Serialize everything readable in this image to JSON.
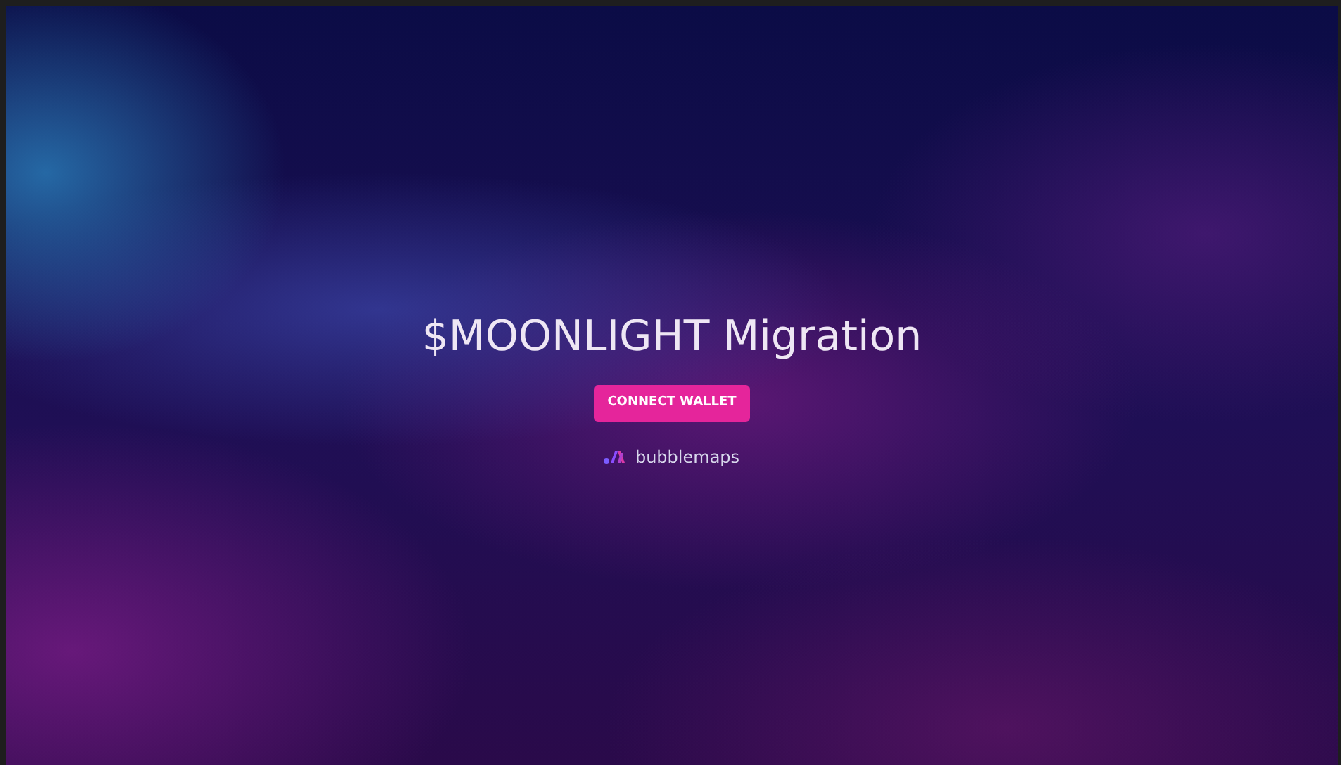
{
  "title": "$MOONLIGHT Migration",
  "connect_button": {
    "label": "CONNECT WALLET"
  },
  "footer_brand": {
    "name": "bubblemaps"
  }
}
